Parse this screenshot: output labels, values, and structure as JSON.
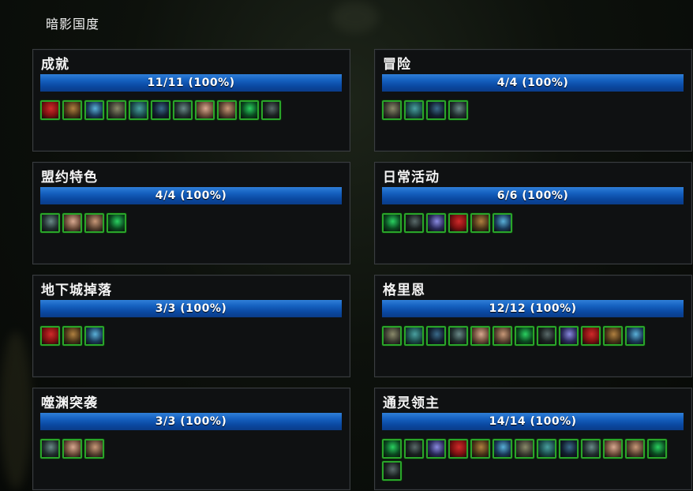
{
  "page_title": "暗影国度",
  "panels": [
    {
      "name": "achievements",
      "title": "成就",
      "progress_text": "11/11 (100%)",
      "progress_fraction": 1.0,
      "icons": [
        "crimson-beast-icon",
        "bronze-crest-icon",
        "frost-mount-icon",
        "stone-beast-icon",
        "teal-mount-icon",
        "dark-wolf-icon",
        "spiked-beast-icon",
        "peach-moth-icon",
        "peach-moth-icon-2",
        "green-crystal-icon",
        "dark-raven-icon"
      ]
    },
    {
      "name": "adventure",
      "title": "冒险",
      "progress_text": "4/4 (100%)",
      "progress_fraction": 1.0,
      "icons": [
        "blue-moth-icon",
        "blue-wing-icon",
        "crimson-horse-icon",
        "dark-hound-icon"
      ]
    },
    {
      "name": "covenant",
      "title": "盟约特色",
      "progress_text": "4/4 (100%)",
      "progress_fraction": 1.0,
      "icons": [
        "silver-wolf-icon",
        "grey-moth-icon",
        "white-serpent-icon",
        "purple-beast-icon"
      ]
    },
    {
      "name": "daily",
      "title": "日常活动",
      "progress_text": "6/6 (100%)",
      "progress_fraction": 1.0,
      "icons": [
        "brown-horse-icon",
        "dark-wing-icon",
        "shadow-beast-icon",
        "purple-toad-icon",
        "magenta-hound-icon",
        "stone-wolf-icon"
      ]
    },
    {
      "name": "dungeon-drops",
      "title": "地下城掉落",
      "progress_text": "3/3 (100%)",
      "progress_fraction": 1.0,
      "icons": [
        "moss-beetle-icon",
        "gear-beetle-icon",
        "bronze-beetle-icon"
      ]
    },
    {
      "name": "gorm",
      "title": "格里恩",
      "progress_text": "12/12 (100%)",
      "progress_fraction": 1.0,
      "icons": [
        "steel-gryphon-icon",
        "bronze-gryphon-icon",
        "amber-gryphon-icon",
        "tan-gryphon-icon",
        "sand-gryphon-icon",
        "gold-gryphon-icon",
        "dark-gryphon-icon",
        "copper-gryphon-icon",
        "white-wing-icon",
        "white-wing-icon-2",
        "pale-wing-icon",
        "dark-steed-icon"
      ]
    },
    {
      "name": "maw-invasion",
      "title": "噬渊突袭",
      "progress_text": "3/3 (100%)",
      "progress_fraction": 1.0,
      "icons": [
        "rust-hound-icon",
        "blue-bird-icon",
        "green-spider-icon"
      ]
    },
    {
      "name": "necro-lords",
      "title": "通灵领主",
      "progress_text": "14/14 (100%)",
      "progress_fraction": 1.0,
      "icons": [
        "bone-horse-icon",
        "olive-horse-icon",
        "grey-horse-icon",
        "moss-horse-icon",
        "teal-horse-icon",
        "dark-horse-icon",
        "slate-horse-icon",
        "rose-horse-icon",
        "brown-horse-icon-2",
        "red-horse-icon",
        "gold-egg-icon",
        "green-egg-icon",
        "yellow-egg-icon",
        "pink-egg-icon"
      ]
    }
  ],
  "colors": {
    "bar": "#1560bf",
    "icon_border": "#2aa52a",
    "panel_bg": "#0f1112"
  }
}
